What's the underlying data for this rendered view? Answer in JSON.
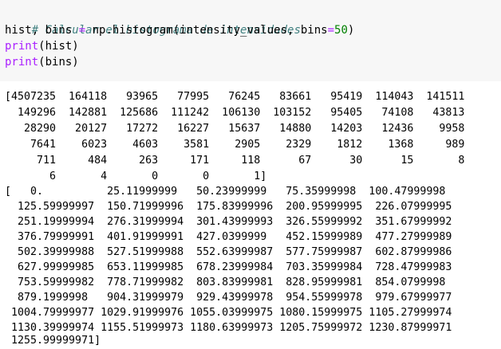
{
  "code_cell": {
    "comment": "# Calcular el histograma de intensidades",
    "line2_left": "hist, bins ",
    "line2_eq": "=",
    "line2_mid": " np.histogram(intensity_values, bins",
    "line2_eq2": "=",
    "line2_num": "50",
    "line2_end": ")",
    "line3_fn": "print",
    "line3_arg": "(hist)",
    "line4_fn": "print",
    "line4_arg": "(bins)"
  },
  "output": {
    "lines": [
      "[4507235  164118   93965   77995   76245   83661   95419  114043  141511",
      "  149296  142881  125686  111242  106130  103152   95405   74108   43813",
      "   28290   20127   17272   16227   15637   14880   14203   12436    9958",
      "    7641    6023    4603    3581    2905    2329    1812    1368     989",
      "     711     484     263     171     118      67      30      15       8",
      "       6       4       0       0       1]",
      "[   0.          25.11999999   50.23999999   75.35999998  100.47999998",
      "  125.59999997  150.71999996  175.83999996  200.95999995  226.07999995",
      "  251.19999994  276.31999994  301.43999993  326.55999992  351.67999992",
      "  376.79999991  401.91999991  427.0399999   452.15999989  477.27999989",
      "  502.39999988  527.51999988  552.63999987  577.75999987  602.87999986",
      "  627.99999985  653.11999985  678.23999984  703.35999984  728.47999983",
      "  753.59999982  778.71999982  803.83999981  828.95999981  854.0799998",
      "  879.1999998   904.31999979  929.43999978  954.55999978  979.67999977",
      " 1004.79999977 1029.91999976 1055.03999975 1080.15999975 1105.27999974",
      " 1130.39999974 1155.51999973 1180.63999973 1205.75999972 1230.87999971",
      " 1255.99999971]"
    ]
  }
}
